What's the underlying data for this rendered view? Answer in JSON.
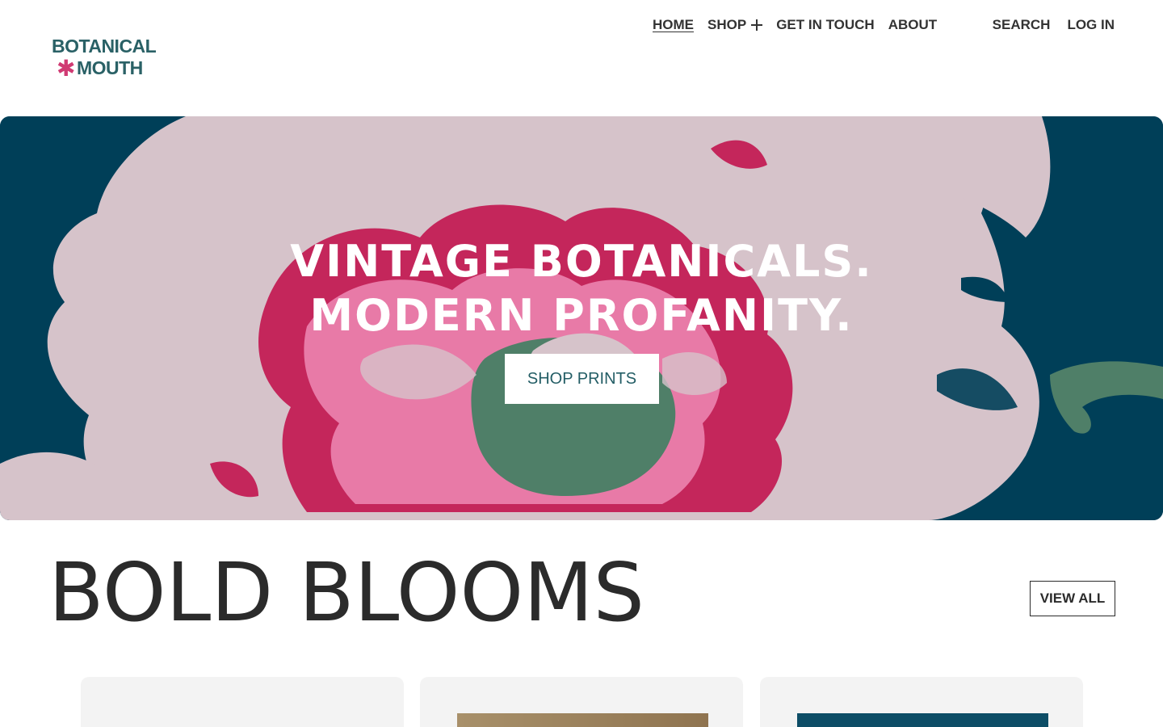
{
  "brand": {
    "line1": "BOTANICAL",
    "line2": "MOUTH",
    "icon": "asterisk-flower-icon"
  },
  "nav": {
    "home": "HOME",
    "shop": "SHOP",
    "contact": "GET IN TOUCH",
    "about": "ABOUT",
    "search": "SEARCH",
    "login": "LOG IN"
  },
  "hero": {
    "title_line1": "VINTAGE BOTANICALS.",
    "title_line2": "MODERN PROFANITY.",
    "cta": "SHOP PRINTS"
  },
  "section": {
    "title": "BOLD BLOOMS",
    "view_all": "VIEW ALL"
  },
  "colors": {
    "brand_teal": "#2a6166",
    "brand_pink": "#d03a73",
    "hero_dark": "#003f58",
    "hero_light_pink": "#d9c4cc",
    "hero_magenta": "#c4265b",
    "hero_green": "#4f7f68",
    "card_bg": "#f3f3f3"
  }
}
